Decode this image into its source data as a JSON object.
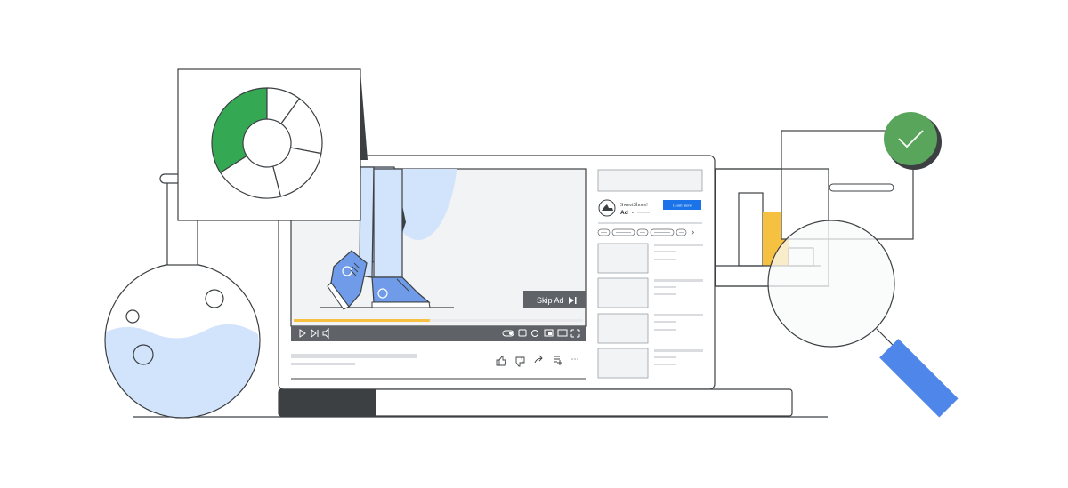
{
  "colors": {
    "outline": "#3c4043",
    "donut_green": "#34a853",
    "video_bg": "#f1f3f4",
    "liquid_blue": "#d2e3fc",
    "pants": "#d2e3fc",
    "shoe_blue": "#6f9be8",
    "progress_yellow": "#f6c141",
    "controls_bar": "#5f6368",
    "skip_bg": "#5f6368",
    "cta_blue": "#1a73e8",
    "bar_yellow": "#f6c141",
    "check_green": "#5aa55c",
    "magnifier_handle": "#4f86e9",
    "placeholder_gray": "#dadce0"
  },
  "icons": {
    "play": "play-icon",
    "next": "next-icon",
    "volume": "volume-icon",
    "autoplay": "autoplay-toggle-icon",
    "captions": "captions-icon",
    "settings": "gear-icon",
    "miniplayer": "miniplayer-icon",
    "theater": "theater-icon",
    "fullscreen": "fullscreen-icon",
    "like": "thumbs-up-icon",
    "dislike": "thumbs-down-icon",
    "share": "share-icon",
    "save": "playlist-add-icon",
    "more": "more-icon",
    "skip": "skip-next-icon",
    "check": "check-icon"
  },
  "player": {
    "skip_label": "Skip Ad",
    "ad_progress": 0.47
  },
  "ad": {
    "brand": "SweetShoes!",
    "badge": "Ad",
    "cta": "Learn more"
  },
  "donut": {
    "green_fraction": 0.34
  }
}
